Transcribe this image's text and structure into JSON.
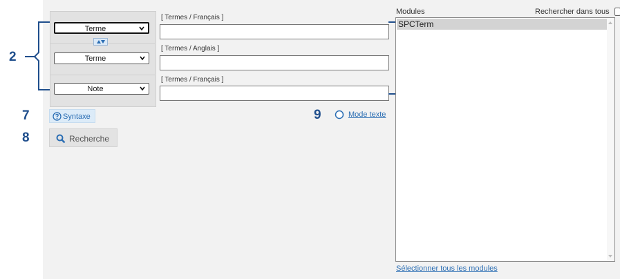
{
  "callouts": {
    "c2": "2",
    "c7": "7",
    "c8": "8",
    "c9": "9"
  },
  "fields": {
    "rows": [
      {
        "select_value": "Terme",
        "label": "[ Termes / Français ]",
        "input_value": ""
      },
      {
        "select_value": "Terme",
        "label": "[ Termes / Anglais ]",
        "input_value": ""
      },
      {
        "select_value": "Note",
        "label": "[ Termes / Français ]",
        "input_value": ""
      }
    ]
  },
  "actions": {
    "syntax_label": "Syntaxe",
    "search_label": "Recherche",
    "mode_texte_label": "Mode texte"
  },
  "modules": {
    "title": "Modules",
    "search_all_label": "Rechercher dans tous",
    "items": [
      "SPCTerm"
    ],
    "select_all_label": "Sélectionner tous les modules"
  },
  "colors": {
    "accent": "#2a6db3",
    "callout": "#1f4e8c"
  }
}
